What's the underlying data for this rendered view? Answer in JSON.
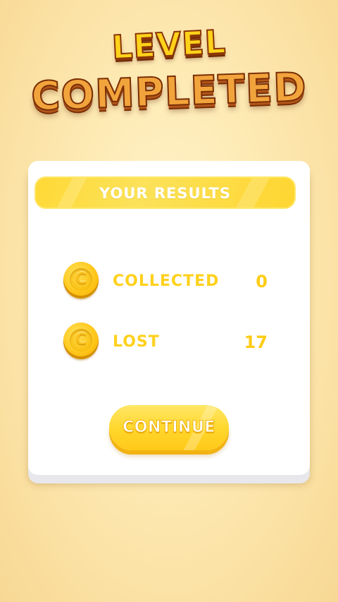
{
  "header": {
    "title_line_1": "LEVEL",
    "title_line_2": "COMPLETED"
  },
  "results": {
    "title": "YOUR RESULTS",
    "rows": [
      {
        "label": "COLLECTED",
        "value": "0",
        "icon": "coin-icon",
        "coin_glyph": "C"
      },
      {
        "label": "LOST",
        "value": "17",
        "icon": "coin-icon",
        "coin_glyph": "C"
      }
    ]
  },
  "actions": {
    "continue_label": "CONTINUE"
  },
  "colors": {
    "accent_yellow": "#ffd11c",
    "title_orange": "#f2a43c",
    "title_outline": "#7a2e06"
  }
}
